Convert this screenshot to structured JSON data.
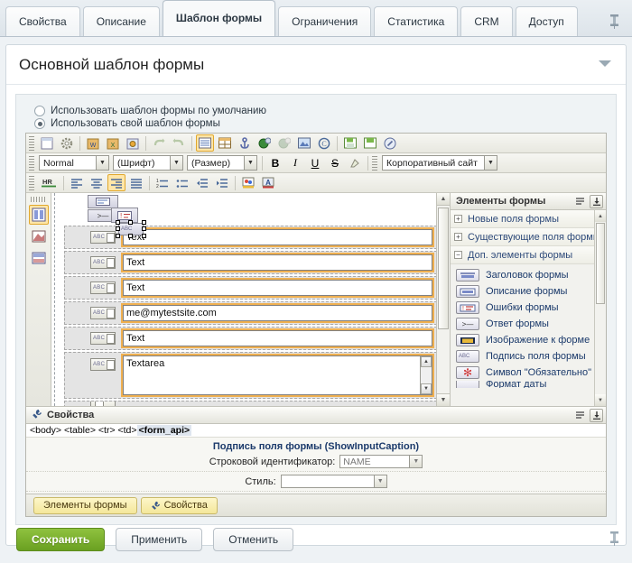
{
  "tabs": [
    {
      "label": "Свойства",
      "active": false
    },
    {
      "label": "Описание",
      "active": false
    },
    {
      "label": "Шаблон формы",
      "active": true
    },
    {
      "label": "Ограничения",
      "active": false
    },
    {
      "label": "Статистика",
      "active": false
    },
    {
      "label": "CRM",
      "active": false
    },
    {
      "label": "Доступ",
      "active": false
    }
  ],
  "tabbar": {
    "pin_icon": "pin-icon"
  },
  "card": {
    "title": "Основной шаблон формы",
    "chevron_icon": "chevron-down-icon"
  },
  "options": {
    "default_template": {
      "label": "Использовать шаблон формы по умолчанию",
      "selected": false
    },
    "custom_template": {
      "label": "Использовать свой шаблон формы",
      "selected": true
    }
  },
  "editor": {
    "toolbar_row1": [
      {
        "name": "new-document-icon",
        "glyph": "▤"
      },
      {
        "name": "settings-gear-icon",
        "glyph": "⚙"
      },
      {
        "name": "import-from-word-icon",
        "glyph": "W"
      },
      {
        "name": "import-from-excel-icon",
        "glyph": "X"
      },
      {
        "name": "preview-icon",
        "glyph": "◉"
      },
      {
        "name": "undo-icon",
        "glyph": "↶"
      },
      {
        "name": "redo-icon",
        "glyph": "↷"
      },
      {
        "name": "insert-form-icon",
        "glyph": "▦",
        "selected": true
      },
      {
        "name": "insert-table-icon",
        "glyph": "▭"
      },
      {
        "name": "insert-anchor-icon",
        "glyph": "⚓"
      },
      {
        "name": "insert-link-icon",
        "glyph": "🌐"
      },
      {
        "name": "remove-link-icon",
        "glyph": "🌐"
      },
      {
        "name": "insert-image-icon",
        "glyph": "🖼"
      },
      {
        "name": "insert-copyright-icon",
        "glyph": "©"
      },
      {
        "name": "save-as-icon",
        "glyph": "▤"
      },
      {
        "name": "save-icon",
        "glyph": "▤"
      },
      {
        "name": "spellcheck-icon",
        "glyph": "◐"
      }
    ],
    "toolbar_row2": {
      "style_select": {
        "value": "Normal",
        "name": "paragraph-style-select"
      },
      "font_select": {
        "value": "(Шрифт)",
        "name": "font-family-select"
      },
      "size_select": {
        "value": "(Размер)",
        "name": "font-size-select"
      },
      "bold": {
        "label": "B",
        "name": "bold-button"
      },
      "italic": {
        "label": "I",
        "name": "italic-button"
      },
      "underline": {
        "label": "U",
        "name": "underline-button"
      },
      "strike": {
        "label": "S",
        "name": "strikethrough-button"
      },
      "eraser": {
        "label": "",
        "name": "remove-format-icon"
      },
      "site_select": {
        "value": "Корпоративный сайт",
        "name": "site-template-select"
      }
    },
    "toolbar_row3": [
      {
        "name": "horizontal-rule-icon",
        "glyph": "HR",
        "selected": false
      },
      {
        "name": "align-left-icon",
        "glyph": "▤"
      },
      {
        "name": "align-center-icon",
        "glyph": "▤"
      },
      {
        "name": "align-right-icon",
        "glyph": "▤",
        "selected": true
      },
      {
        "name": "align-justify-icon",
        "glyph": "▤"
      },
      {
        "name": "numbered-list-icon",
        "glyph": "≔"
      },
      {
        "name": "bulleted-list-icon",
        "glyph": "≔"
      },
      {
        "name": "outdent-icon",
        "glyph": "⇤"
      },
      {
        "name": "indent-icon",
        "glyph": "⇥"
      },
      {
        "name": "background-color-icon",
        "glyph": "🎨"
      },
      {
        "name": "font-color-icon",
        "glyph": "A"
      }
    ],
    "vertical_tools": [
      {
        "name": "form-view-tool",
        "selected": true
      },
      {
        "name": "fields-tool",
        "selected": false
      },
      {
        "name": "layout-tool",
        "selected": false
      }
    ],
    "form_rows": [
      {
        "caption_icon": "abc",
        "value": "Text",
        "type": "input",
        "selected": true
      },
      {
        "caption_icon": "abc",
        "value": "Text",
        "type": "input"
      },
      {
        "caption_icon": "abc",
        "value": "Text",
        "type": "input"
      },
      {
        "caption_icon": "abc",
        "value": "me@mytestsite.com",
        "type": "input"
      },
      {
        "caption_icon": "abc",
        "value": "Text",
        "type": "input"
      },
      {
        "caption_icon": "abc",
        "value": "Textarea",
        "type": "textarea"
      }
    ]
  },
  "dock": {
    "header": {
      "title": "Элементы формы",
      "menu_icon": "list-menu-icon",
      "collapse_icon": "collapse-down-icon"
    },
    "groups": [
      {
        "label": "Новые поля формы",
        "expanded": false,
        "sign": "+"
      },
      {
        "label": "Существующие поля формы",
        "expanded": false,
        "sign": "+"
      },
      {
        "label": "Доп. элементы формы",
        "expanded": true,
        "sign": "−"
      }
    ],
    "elements": [
      {
        "label": "Заголовок формы",
        "icon": "form-title-icon"
      },
      {
        "label": "Описание формы",
        "icon": "form-description-icon"
      },
      {
        "label": "Ошибки формы",
        "icon": "form-errors-icon"
      },
      {
        "label": "Ответ формы",
        "icon": "form-answer-icon"
      },
      {
        "label": "Изображение к форме",
        "icon": "form-image-icon"
      },
      {
        "label": "Подпись поля формы",
        "icon": "form-field-caption-icon"
      },
      {
        "label": "Символ \"Обязательно\"",
        "icon": "required-symbol-icon"
      },
      {
        "label": "Формат даты",
        "icon": "date-format-icon"
      }
    ]
  },
  "properties": {
    "header": {
      "title": "Свойства",
      "wrench_icon": "wrench-icon",
      "menu_icon": "list-menu-icon",
      "collapse_icon": "collapse-down-icon"
    },
    "breadcrumb": "<body> <table> <tr> <td> ",
    "breadcrumb_current": "<form_api>",
    "title": "Подпись поля формы (ShowInputCaption)",
    "fields": [
      {
        "label": "Строковой идентификатор:",
        "value": "NAME",
        "control": "select",
        "name": "string-identifier-select"
      },
      {
        "label": "Стиль:",
        "value": "",
        "control": "select",
        "name": "style-select"
      }
    ],
    "extra_box": {
      "value": "",
      "name": "style-custom-input"
    }
  },
  "dock_tabs": [
    {
      "label": "Элементы формы",
      "name": "dock-tab-form-elements",
      "icon": ""
    },
    {
      "label": "Свойства",
      "name": "dock-tab-properties",
      "icon": "wrench-icon"
    }
  ],
  "footer": {
    "save": "Сохранить",
    "apply": "Применить",
    "cancel": "Отменить",
    "pin_icon": "pin-icon"
  },
  "colors": {
    "primary_button": "#7bb12e",
    "selected_toolbar": "#ffe6a8",
    "field_outline": "#f0b050",
    "dock_tab": "#f4e79a"
  }
}
